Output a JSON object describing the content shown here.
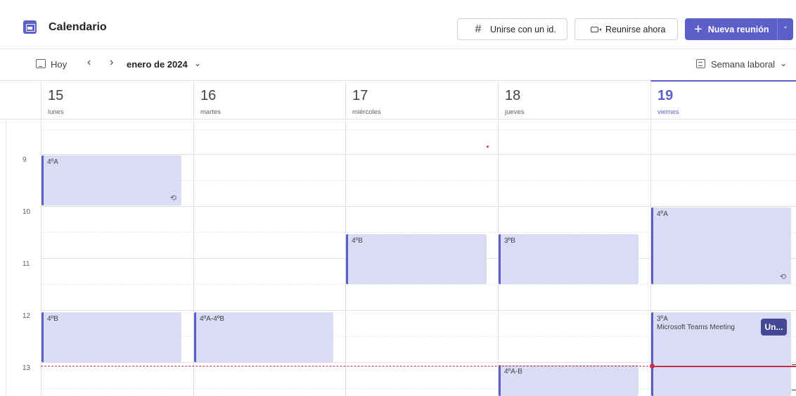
{
  "header": {
    "title": "Calendario",
    "app_icon": "calendar-icon",
    "join_with_id": "Unirse con un id.",
    "meet_now": "Reunirse ahora",
    "new_meeting": "Nueva reunión",
    "accent": "#5b5fc7"
  },
  "toolbar": {
    "today": "Hoy",
    "month": "enero de 2024",
    "view": "Semana laboral"
  },
  "days": [
    {
      "num": "15",
      "name": "lunes"
    },
    {
      "num": "16",
      "name": "martes"
    },
    {
      "num": "17",
      "name": "miércoles"
    },
    {
      "num": "18",
      "name": "jueves"
    },
    {
      "num": "19",
      "name": "viernes"
    }
  ],
  "hours": [
    "9",
    "10",
    "11",
    "12",
    "13"
  ],
  "events": {
    "mon_9": {
      "title": "4ºA"
    },
    "mon_12": {
      "title": "4ºB"
    },
    "tue_12": {
      "title": "4ºA-4ºB"
    },
    "wed_1030": {
      "title": "4ºB"
    },
    "thu_1030": {
      "title": "3ºB"
    },
    "thu_13": {
      "title": "4ºA-B"
    },
    "fri_10": {
      "title": "4ºA"
    },
    "fri_12": {
      "title": "3ºA",
      "subtitle": "Microsoft Teams Meeting",
      "join_label": "Un..."
    }
  },
  "colors": {
    "event_fill": "#dadcf6",
    "event_border": "#5b5fc7",
    "now_indicator": "#c4314b"
  }
}
